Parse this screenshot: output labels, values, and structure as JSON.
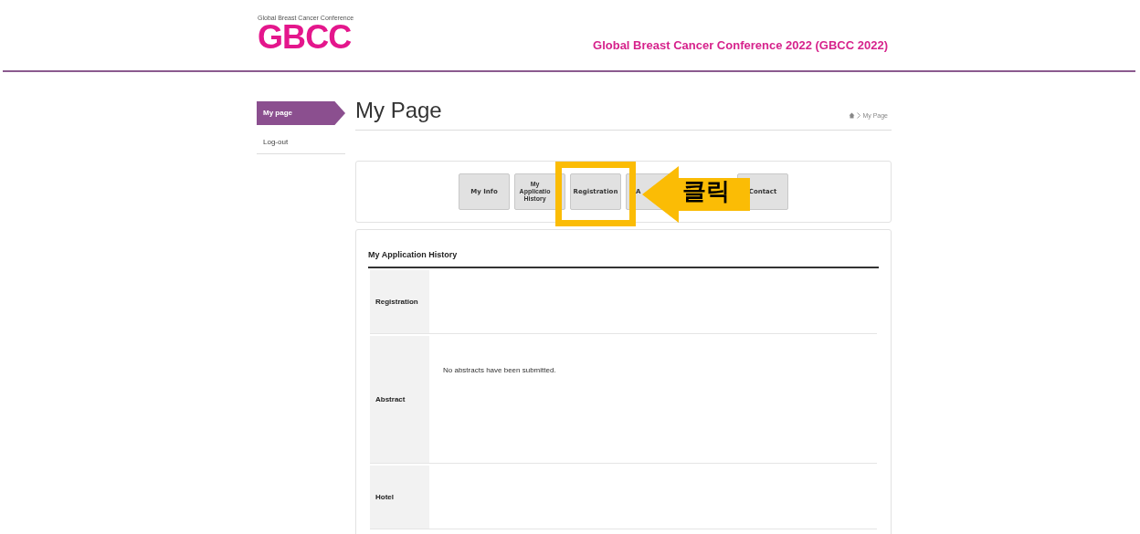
{
  "header": {
    "logo_caption": "Global Breast Cancer Conference",
    "logo": "GBCC",
    "title": "Global Breast Cancer Conference 2022 (GBCC 2022)"
  },
  "sidebar": {
    "items": [
      {
        "label": "My page",
        "selected": true
      },
      {
        "label": "Log-out",
        "selected": false
      }
    ]
  },
  "page": {
    "title": "My Page",
    "breadcrumb": "My Page"
  },
  "menu_buttons": [
    {
      "kind": "button",
      "label": "My Info"
    },
    {
      "kind": "button",
      "label": "My Applicatio History"
    },
    {
      "kind": "button",
      "label": "Registration"
    },
    {
      "kind": "button",
      "label": "A"
    },
    {
      "kind": "hidden"
    },
    {
      "kind": "button",
      "label": "Contact"
    }
  ],
  "callout": {
    "text": "클릭"
  },
  "history": {
    "title": "My Application History",
    "rows": [
      {
        "label": "Registration"
      },
      {
        "label": "Abstract",
        "value": "No abstracts have been submitted."
      },
      {
        "label": "Hotel"
      }
    ]
  }
}
